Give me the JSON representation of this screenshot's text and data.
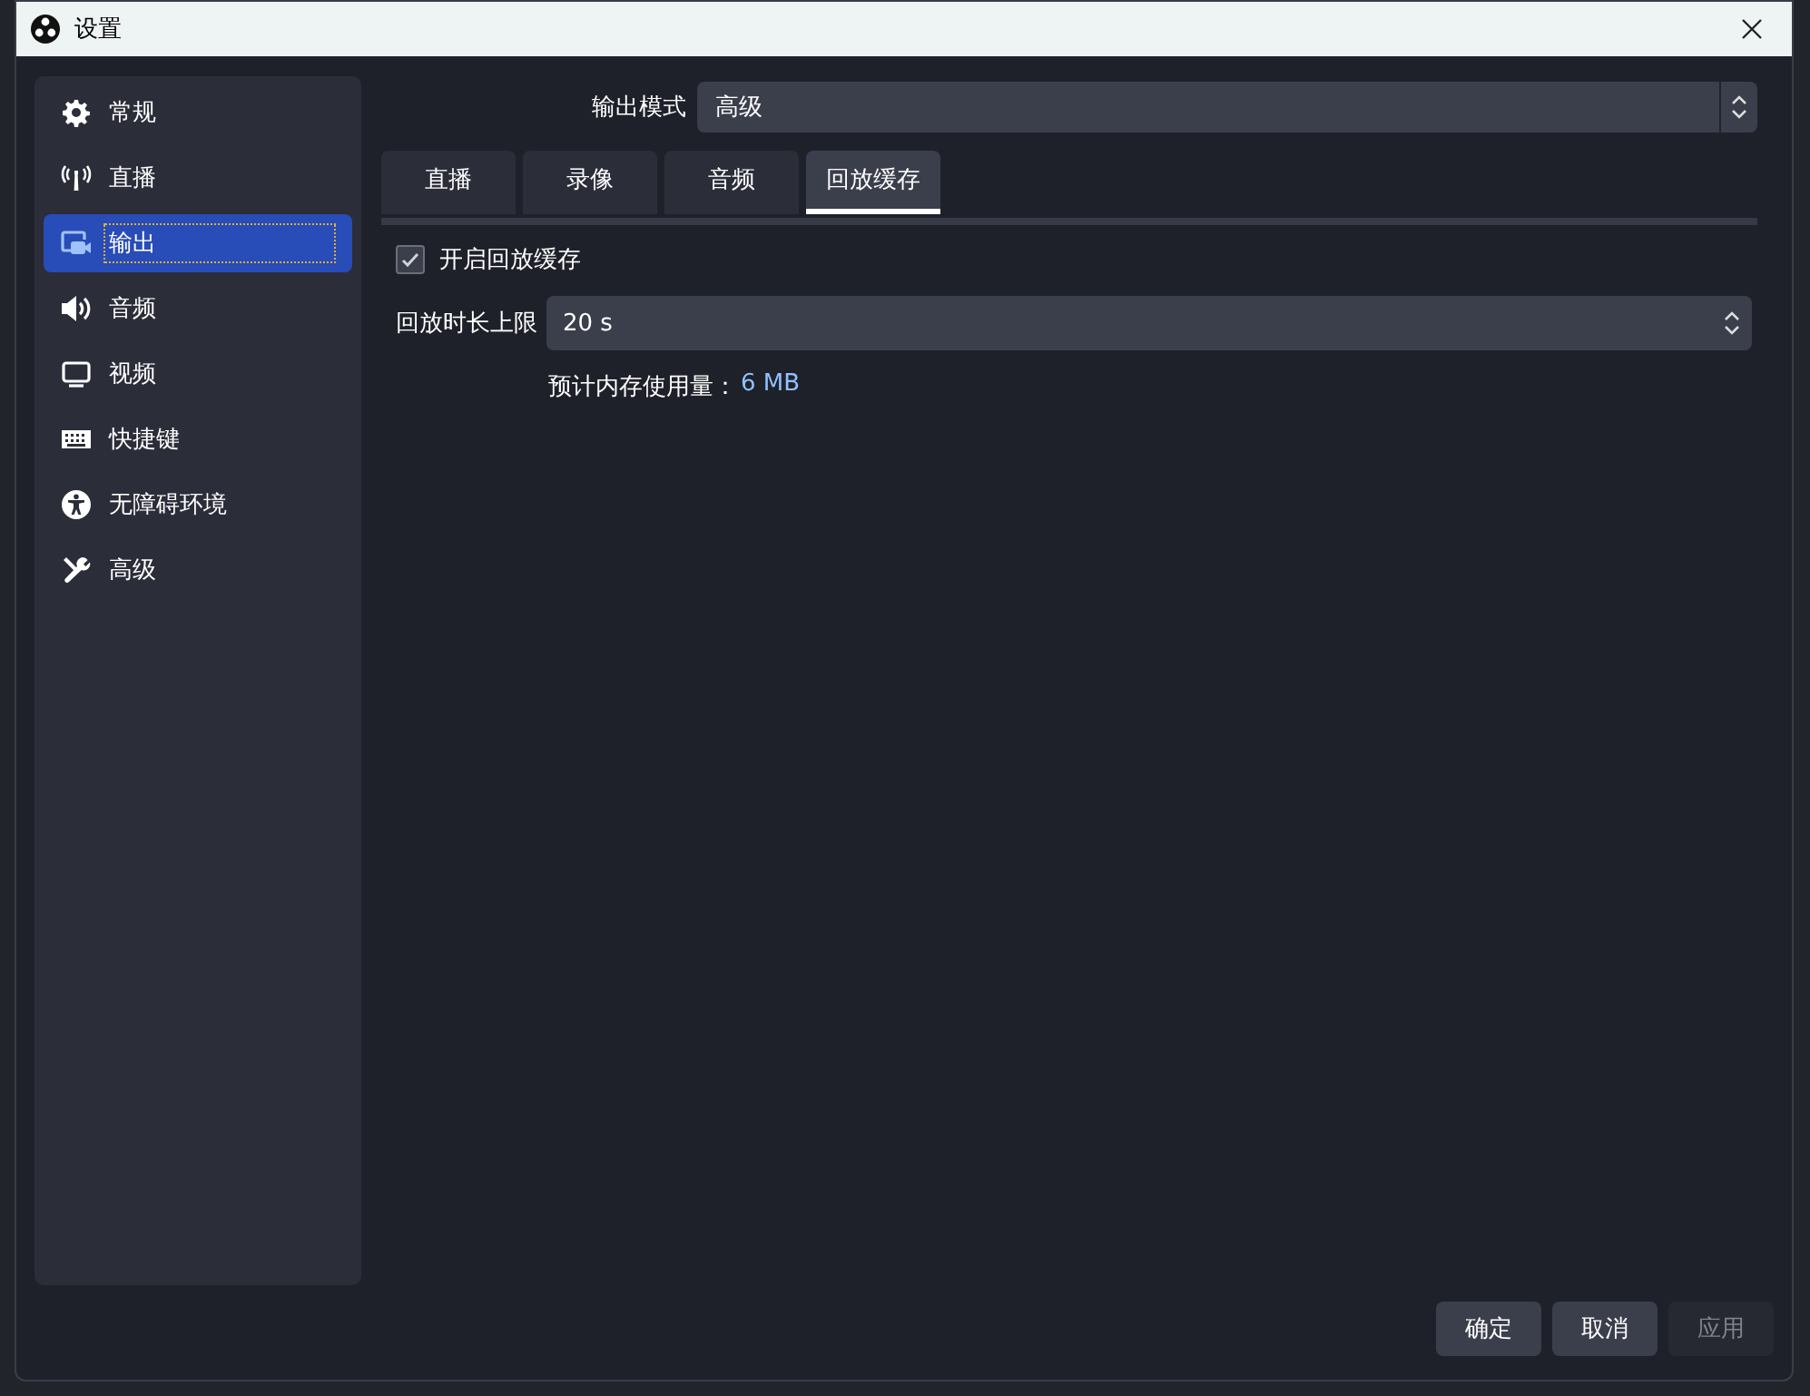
{
  "window": {
    "title": "设置"
  },
  "sidebar": {
    "items": [
      {
        "label": "常规",
        "selected": false
      },
      {
        "label": "直播",
        "selected": false
      },
      {
        "label": "输出",
        "selected": true
      },
      {
        "label": "音频",
        "selected": false
      },
      {
        "label": "视频",
        "selected": false
      },
      {
        "label": "快捷键",
        "selected": false
      },
      {
        "label": "无障碍环境",
        "selected": false
      },
      {
        "label": "高级",
        "selected": false
      }
    ]
  },
  "output_mode": {
    "label": "输出模式",
    "value": "高级"
  },
  "tabs": [
    {
      "label": "直播",
      "selected": false
    },
    {
      "label": "录像",
      "selected": false
    },
    {
      "label": "音频",
      "selected": false
    },
    {
      "label": "回放缓存",
      "selected": true
    }
  ],
  "replay_buffer": {
    "enable": {
      "label": "开启回放缓存",
      "checked": true
    },
    "max_time": {
      "label": "回放时长上限",
      "value": "20 s"
    },
    "memory": {
      "label": "预计内存使用量：",
      "value": "6 MB"
    }
  },
  "buttons": [
    {
      "label": "确定",
      "disabled": false
    },
    {
      "label": "取消",
      "disabled": false
    },
    {
      "label": "应用",
      "disabled": true
    }
  ]
}
